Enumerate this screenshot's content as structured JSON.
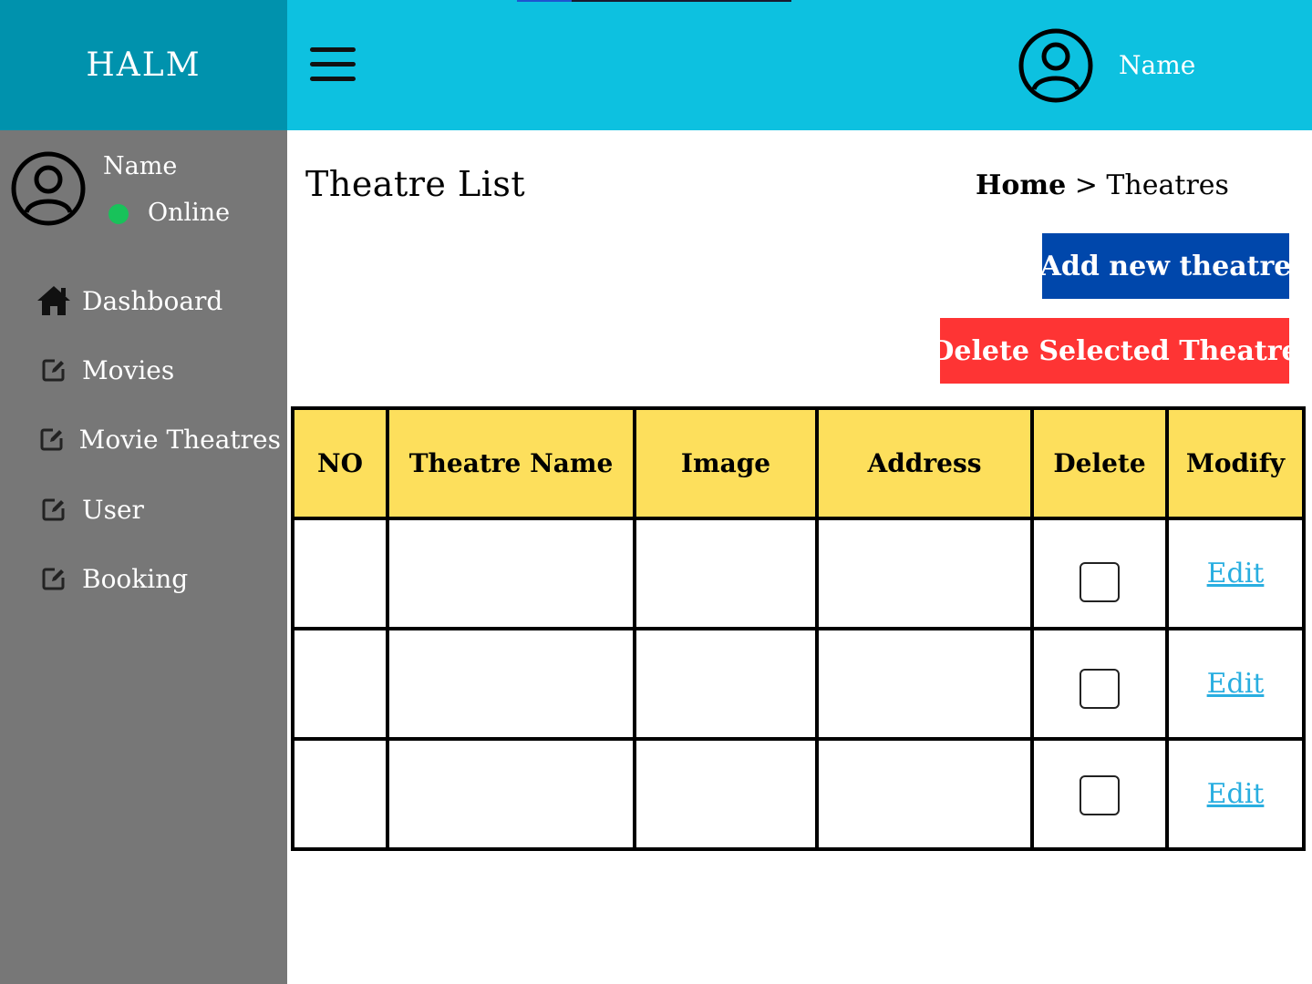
{
  "app": {
    "brand": "HALM"
  },
  "header": {
    "username": "Name",
    "menu_icon": "hamburger-icon",
    "avatar_icon": "user-avatar-icon"
  },
  "sidebar": {
    "user": {
      "name": "Name",
      "status": "Online",
      "status_color": "#18c25a"
    },
    "items": [
      {
        "label": "Dashboard",
        "icon": "home-icon"
      },
      {
        "label": "Movies",
        "icon": "edit-icon"
      },
      {
        "label": "Movie Theatres",
        "icon": "edit-icon"
      },
      {
        "label": "User",
        "icon": "edit-icon"
      },
      {
        "label": "Booking",
        "icon": "edit-icon"
      }
    ]
  },
  "main": {
    "title": "Theatre List",
    "breadcrumb": {
      "home": "Home",
      "separator": ">",
      "current": "Theatres"
    },
    "buttons": {
      "add": "Add new theatre",
      "delete_selected": "Delete Selected Theatre"
    },
    "table": {
      "columns": [
        "NO",
        "Theatre Name",
        "Image",
        "Address",
        "Delete",
        "Modify"
      ],
      "rows": [
        {
          "no": "",
          "name": "",
          "image": "",
          "address": "",
          "selected": false,
          "modify": "Edit"
        },
        {
          "no": "",
          "name": "",
          "image": "",
          "address": "",
          "selected": false,
          "modify": "Edit"
        },
        {
          "no": "",
          "name": "",
          "image": "",
          "address": "",
          "selected": false,
          "modify": "Edit"
        }
      ]
    }
  },
  "colors": {
    "brand_bg": "#0092ad",
    "topbar_bg": "#0dc1e0",
    "sidebar_bg": "#777777",
    "add_button": "#0047ab",
    "delete_button": "#fe3434",
    "table_header": "#fddf5c",
    "link": "#29aee0"
  }
}
